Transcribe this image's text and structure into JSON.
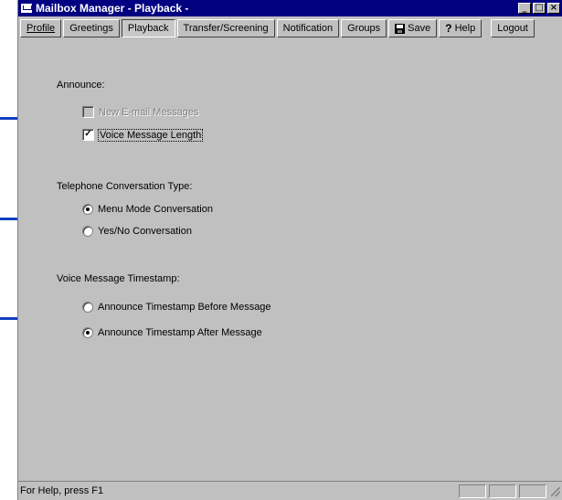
{
  "window": {
    "title": "Mailbox Manager - Playback -",
    "minimize": "_",
    "maximize": "□",
    "close": "×"
  },
  "toolbar": {
    "profile": "Profile",
    "greetings": "Greetings",
    "playback": "Playback",
    "transfer": "Transfer/Screening",
    "notification": "Notification",
    "groups": "Groups",
    "save": "Save",
    "help": "Help",
    "logout": "Logout"
  },
  "announce": {
    "heading": "Announce:",
    "new_email": {
      "label": "New E-mail Messages",
      "checked": false,
      "enabled": false
    },
    "voice_length": {
      "label": "Voice Message Length",
      "checked": true,
      "enabled": true
    }
  },
  "conversation": {
    "heading": "Telephone Conversation Type:",
    "menu_mode": {
      "label": "Menu Mode Conversation",
      "selected": true
    },
    "yes_no": {
      "label": "Yes/No Conversation",
      "selected": false
    }
  },
  "timestamp": {
    "heading": "Voice Message Timestamp:",
    "before": {
      "label": "Announce Timestamp Before Message",
      "selected": false
    },
    "after": {
      "label": "Announce Timestamp After Message",
      "selected": true
    }
  },
  "status": {
    "text": "For Help, press F1"
  },
  "colors": {
    "titlebar": "#000080",
    "face": "#c0c0c0",
    "callout": "#1040c0"
  },
  "icons": {
    "app": "mailbox-icon",
    "save": "floppy-disk-icon",
    "help": "question-mark-icon"
  }
}
